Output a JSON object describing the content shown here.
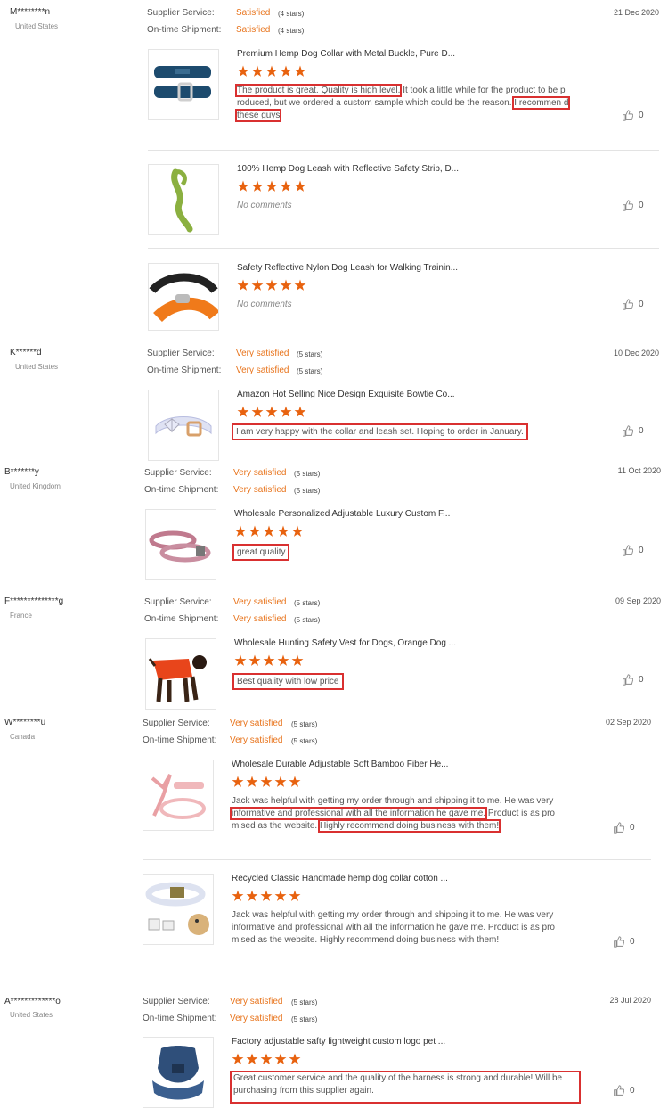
{
  "labels": {
    "supplier_service": "Supplier Service:",
    "ontime_shipment": "On-time Shipment:"
  },
  "reviews": [
    {
      "buyer": "M********n",
      "country": "United States",
      "date": "21 Dec 2020",
      "supplier_rating": "Satisfied",
      "supplier_stars": "(4 stars)",
      "shipment_rating": "Satisfied",
      "shipment_stars": "(4 stars)",
      "products": [
        {
          "title": "Premium Hemp Dog Collar with Metal Buckle, Pure D...",
          "stars": 5,
          "comment_parts": [
            "The product is great. Quality is high level.",
            " It took a little while for the product to be p roduced, but we ordered a custom sample which could be the reason. ",
            "I recommen d these guys"
          ],
          "likes": "0"
        },
        {
          "title": "100% Hemp Dog Leash with Reflective Safety Strip, D...",
          "stars": 5,
          "comment": "No comments",
          "likes": "0"
        },
        {
          "title": "Safety Reflective Nylon Dog Leash for Walking Trainin...",
          "stars": 5,
          "comment": "No comments",
          "likes": "0"
        }
      ]
    },
    {
      "buyer": "K******d",
      "country": "United States",
      "date": "10 Dec 2020",
      "supplier_rating": "Very satisfied",
      "supplier_stars": "(5 stars)",
      "shipment_rating": "Very satisfied",
      "shipment_stars": "(5 stars)",
      "products": [
        {
          "title": "Amazon Hot Selling Nice Design Exquisite Bowtie Co...",
          "stars": 5,
          "comment": "I am very happy with the collar and leash set. Hoping to order in January.",
          "likes": "0"
        }
      ]
    },
    {
      "buyer": "B*******y",
      "country": "United Kingdom",
      "date": "11 Oct 2020",
      "supplier_rating": "Very satisfied",
      "supplier_stars": "(5 stars)",
      "shipment_rating": "Very satisfied",
      "shipment_stars": "(5 stars)",
      "products": [
        {
          "title": "Wholesale Personalized Adjustable Luxury Custom F...",
          "stars": 5,
          "comment": "great quality",
          "likes": "0"
        }
      ]
    },
    {
      "buyer": "F**************g",
      "country": "France",
      "date": "09 Sep 2020",
      "supplier_rating": "Very satisfied",
      "supplier_stars": "(5 stars)",
      "shipment_rating": "Very satisfied",
      "shipment_stars": "(5 stars)",
      "products": [
        {
          "title": "Wholesale Hunting Safety Vest for Dogs, Orange Dog ...",
          "stars": 5,
          "comment": "Best quality with low price",
          "likes": "0"
        }
      ]
    },
    {
      "buyer": "W********u",
      "country": "Canada",
      "date": "02 Sep 2020",
      "supplier_rating": "Very satisfied",
      "supplier_stars": "(5 stars)",
      "shipment_rating": "Very satisfied",
      "shipment_stars": "(5 stars)",
      "products": [
        {
          "title": "Wholesale Durable Adjustable Soft Bamboo Fiber He...",
          "stars": 5,
          "comment_parts": [
            "Jack was helpful with getting my order through and shipping it to me. He was very ",
            "informative and professional with all the information he gave me.",
            " Product is as pro mised as the website. ",
            "Highly recommend doing business with them!"
          ],
          "likes": "0"
        },
        {
          "title": "Recycled Classic Handmade hemp dog collar cotton ...",
          "stars": 5,
          "comment": "Jack was helpful with getting my order through and shipping it to me. He was very informative and professional with all the information he gave me. Product is as pro mised as the website. Highly recommend doing business with them!",
          "likes": "0"
        }
      ]
    },
    {
      "buyer": "A*************o",
      "country": "United States",
      "date": "28 Jul 2020",
      "supplier_rating": "Very satisfied",
      "supplier_stars": "(5 stars)",
      "shipment_rating": "Very satisfied",
      "shipment_stars": "(5 stars)",
      "products": [
        {
          "title": "Factory adjustable safty lightweight custom logo pet ...",
          "stars": 5,
          "comment": "Great customer service and the quality of the harness is strong and durable! Will be purchasing from this supplier again.",
          "likes": "0"
        }
      ]
    }
  ],
  "colors": {
    "accent": "#e8741c",
    "star": "#e8620f",
    "highlight": "#d93030"
  },
  "icons": {
    "like": "thumbs-up-icon"
  }
}
